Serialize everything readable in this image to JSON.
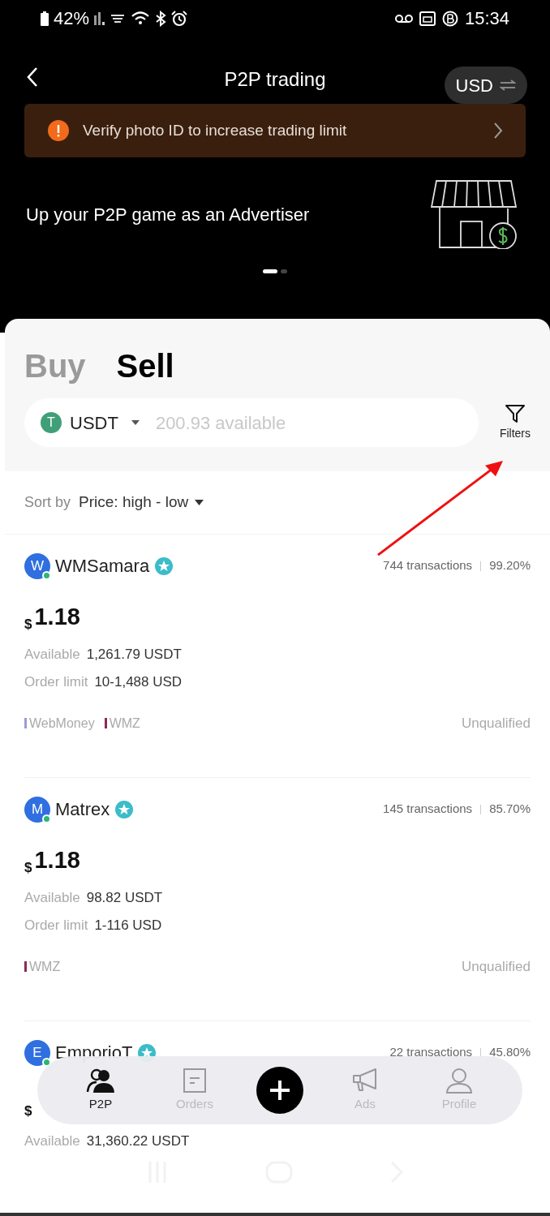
{
  "status_bar": {
    "battery": "42%",
    "time": "15:34"
  },
  "header": {
    "title": "P2P trading",
    "currency": "USD"
  },
  "notice": {
    "text": "Verify photo ID to increase trading limit"
  },
  "promo": {
    "text": "Up your P2P game as an Advertiser",
    "pages": [
      {
        "selected": true
      },
      {
        "selected": false
      }
    ]
  },
  "tabs": [
    {
      "label": "Buy",
      "selected": false
    },
    {
      "label": "Sell",
      "selected": true
    }
  ],
  "asset": {
    "coin_letter": "T",
    "coin": "USDT",
    "available": "200.93 available"
  },
  "filters": {
    "label": "Filters"
  },
  "sort": {
    "label": "Sort by",
    "value": "Price: high - low"
  },
  "offers": [
    {
      "avatar": "W",
      "name": "WMSamara",
      "transactions": "744 transactions",
      "completion": "99.20%",
      "currency_symbol": "$",
      "price": "1.18",
      "available_label": "Available",
      "available": "1,261.79 USDT",
      "limit_label": "Order limit",
      "limit": "10-1,488 USD",
      "payments": [
        {
          "name": "WebMoney",
          "color": "#9b9bd6"
        },
        {
          "name": "WMZ",
          "color": "#8a2a5a"
        }
      ],
      "status": "Unqualified"
    },
    {
      "avatar": "M",
      "name": "Matrex",
      "transactions": "145 transactions",
      "completion": "85.70%",
      "currency_symbol": "$",
      "price": "1.18",
      "available_label": "Available",
      "available": "98.82 USDT",
      "limit_label": "Order limit",
      "limit": "1-116 USD",
      "payments": [
        {
          "name": "WMZ",
          "color": "#8a2a5a"
        }
      ],
      "status": "Unqualified"
    },
    {
      "avatar": "E",
      "name": "EmporioT",
      "transactions": "22 transactions",
      "completion": "45.80%",
      "currency_symbol": "$",
      "available_label": "Available",
      "available": "31,360.22 USDT"
    }
  ],
  "bottom_nav": [
    {
      "label": "P2P",
      "selected": true
    },
    {
      "label": "Orders",
      "selected": false
    },
    {
      "kind": "add"
    },
    {
      "label": "Ads",
      "selected": false
    },
    {
      "label": "Profile",
      "selected": false
    }
  ]
}
